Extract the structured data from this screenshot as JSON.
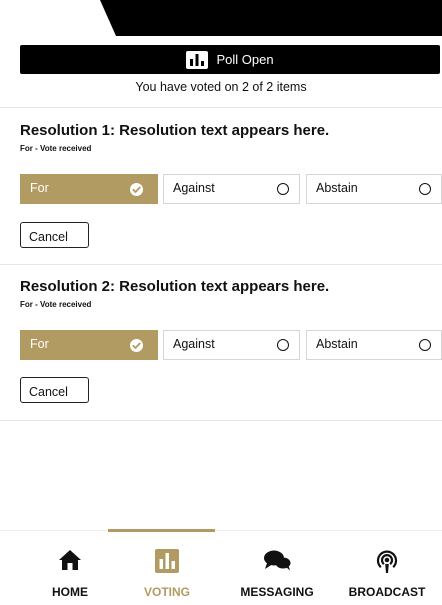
{
  "poll_banner": {
    "label": "Poll Open",
    "icon": "bar-chart-icon"
  },
  "voted_summary": "You have voted on 2 of 2 items",
  "resolutions": [
    {
      "title": "Resolution 1: Resolution text appears here.",
      "status": "For - Vote received",
      "options": [
        {
          "label": "For",
          "selected": true
        },
        {
          "label": "Against",
          "selected": false
        },
        {
          "label": "Abstain",
          "selected": false
        }
      ],
      "cancel_label": "Cancel"
    },
    {
      "title": "Resolution 2: Resolution text appears here.",
      "status": "For - Vote received",
      "options": [
        {
          "label": "For",
          "selected": true
        },
        {
          "label": "Against",
          "selected": false
        },
        {
          "label": "Abstain",
          "selected": false
        }
      ],
      "cancel_label": "Cancel"
    }
  ],
  "nav": {
    "active": "voting",
    "items": [
      {
        "id": "home",
        "label": "HOME",
        "icon": "home-icon"
      },
      {
        "id": "voting",
        "label": "VOTING",
        "icon": "bar-chart-icon"
      },
      {
        "id": "messaging",
        "label": "MESSAGING",
        "icon": "chat-bubbles-icon"
      },
      {
        "id": "broadcast",
        "label": "BROADCAST",
        "icon": "podcast-icon"
      }
    ]
  },
  "colors": {
    "accent": "#b29b63",
    "banner": "#000000",
    "text": "#111111"
  }
}
